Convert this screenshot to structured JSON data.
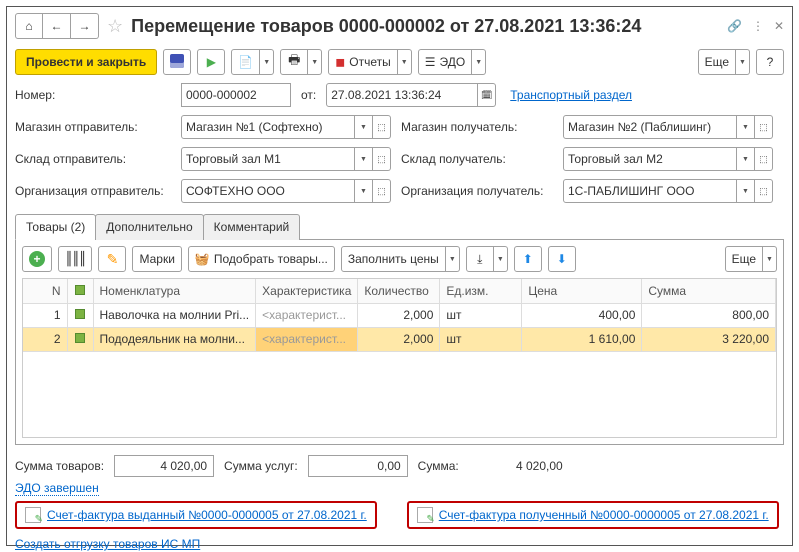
{
  "window": {
    "title": "Перемещение товаров 0000-000002 от 27.08.2021 13:36:24"
  },
  "toolbar": {
    "post_close": "Провести и закрыть",
    "reports": "Отчеты",
    "edo": "ЭДО",
    "more": "Еще"
  },
  "header": {
    "number_lbl": "Номер:",
    "number": "0000-000002",
    "from_lbl": "от:",
    "date": "27.08.2021 13:36:24",
    "transport_link": "Транспортный раздел",
    "sender_store_lbl": "Магазин отправитель:",
    "sender_store": "Магазин №1 (Софтехно)",
    "receiver_store_lbl": "Магазин получатель:",
    "receiver_store": "Магазин №2 (Паблишинг)",
    "sender_wh_lbl": "Склад отправитель:",
    "sender_wh": "Торговый зал М1",
    "receiver_wh_lbl": "Склад получатель:",
    "receiver_wh": "Торговый зал М2",
    "sender_org_lbl": "Организация отправитель:",
    "sender_org": "СОФТЕХНО ООО",
    "receiver_org_lbl": "Организация получатель:",
    "receiver_org": "1С-ПАБЛИШИНГ ООО"
  },
  "tabs": {
    "goods": "Товары (2)",
    "additional": "Дополнительно",
    "comment": "Комментарий"
  },
  "tab_toolbar": {
    "marks": "Марки",
    "pick": "Подобрать товары...",
    "fill_prices": "Заполнить цены",
    "more": "Еще"
  },
  "columns": {
    "n": "N",
    "nom": "Номенклатура",
    "char": "Характеристика",
    "qty": "Количество",
    "unit": "Ед.изм.",
    "price": "Цена",
    "sum": "Сумма"
  },
  "rows": [
    {
      "n": "1",
      "nom": "Наволочка на молнии Pri...",
      "char": "<характерист...",
      "qty": "2,000",
      "unit": "шт",
      "price": "400,00",
      "sum": "800,00"
    },
    {
      "n": "2",
      "nom": "Пододеяльник на молни...",
      "char": "<характерист...",
      "qty": "2,000",
      "unit": "шт",
      "price": "1 610,00",
      "sum": "3 220,00"
    }
  ],
  "totals": {
    "goods_lbl": "Сумма товаров:",
    "goods": "4 020,00",
    "services_lbl": "Сумма услуг:",
    "services": "0,00",
    "sum_lbl": "Сумма:",
    "sum": "4 020,00"
  },
  "edo_status": "ЭДО завершен",
  "invoice_out": "Счет-фактура выданный №0000-0000005 от 27.08.2021 г.",
  "invoice_in": "Счет-фактура полученный №0000-0000005 от 27.08.2021 г.",
  "bottom_link": "Создать отгрузку товаров ИС МП"
}
